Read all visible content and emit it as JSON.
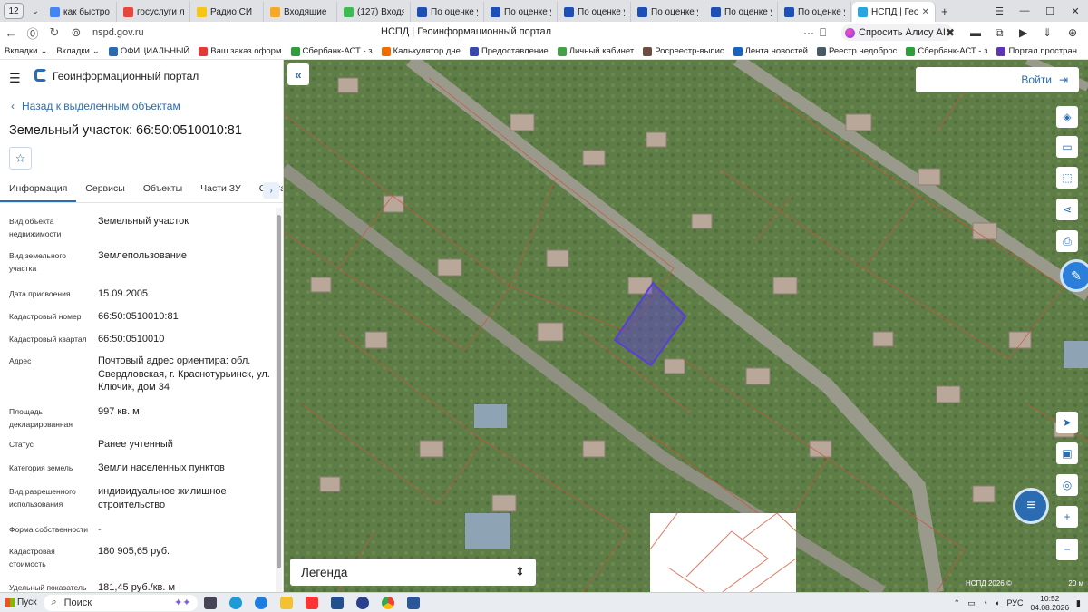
{
  "browser": {
    "tab_count": "12",
    "tabs": [
      {
        "label": "как быстро д",
        "color": "#4285f4"
      },
      {
        "label": "госуслуги ли",
        "color": "#e8453c"
      },
      {
        "label": "Радио СИ",
        "color": "#f5c518"
      },
      {
        "label": "Входящие",
        "color": "#f9a825"
      },
      {
        "label": "(127) Входящ",
        "color": "#3cba54"
      },
      {
        "label": "По оценке ур",
        "color": "#1e4fb4"
      },
      {
        "label": "По оценке ур",
        "color": "#1e4fb4"
      },
      {
        "label": "По оценке ур",
        "color": "#1e4fb4"
      },
      {
        "label": "По оценке ур",
        "color": "#1e4fb4"
      },
      {
        "label": "По оценке ур",
        "color": "#1e4fb4"
      },
      {
        "label": "По оценке ур",
        "color": "#1e4fb4"
      },
      {
        "label": "НСПД | Гео",
        "color": "#2aa6df"
      }
    ],
    "url": "nspd.gov.ru",
    "page_title": "НСПД | Геоинформационный портал",
    "alisa_label": "Спросить Алису AI",
    "bookmarks": [
      {
        "label": "Вкладки",
        "color": ""
      },
      {
        "label": "Вкладки",
        "color": ""
      },
      {
        "label": "ОФИЦИАЛЬНЫЙ",
        "color": "#2b6cb0"
      },
      {
        "label": "Ваш заказ оформ",
        "color": "#e53935"
      },
      {
        "label": "Сбербанк-АСТ - з",
        "color": "#2e9d3a"
      },
      {
        "label": "Калькулятор дне",
        "color": "#ef6c00"
      },
      {
        "label": "Предоставление",
        "color": "#3949ab"
      },
      {
        "label": "Личный кабинет",
        "color": "#43a047"
      },
      {
        "label": "Росреестр-выпис",
        "color": "#6d4c41"
      },
      {
        "label": "Лента новостей",
        "color": "#1565c0"
      },
      {
        "label": "Реестр недоброс",
        "color": "#455a64"
      },
      {
        "label": "Сбербанк-АСТ - з",
        "color": "#2e9d3a"
      },
      {
        "label": "Портал простран",
        "color": "#5e35b1"
      }
    ]
  },
  "portal": {
    "title": "Геоинформационный портал",
    "back_label": "Назад к выделенным объектам",
    "object_title": "Земельный участок: 66:50:0510010:81",
    "tabs": [
      "Информация",
      "Сервисы",
      "Объекты",
      "Части ЗУ",
      "Состав"
    ],
    "properties": [
      {
        "label": "Вид объекта недвижимости",
        "value": "Земельный участок"
      },
      {
        "label": "Вид земельного участка",
        "value": "Землепользование"
      },
      {
        "label": "Дата присвоения",
        "value": "15.09.2005"
      },
      {
        "label": "Кадастровый номер",
        "value": "66:50:0510010:81"
      },
      {
        "label": "Кадастровый квартал",
        "value": "66:50:0510010"
      },
      {
        "label": "Адрес",
        "value": "Почтовый адрес ориентира: обл. Свердловская, г. Краснотурьинск, ул. Ключик, дом 34"
      },
      {
        "label": "Площадь декларированная",
        "value": "997 кв. м"
      },
      {
        "label": "Статус",
        "value": "Ранее учтенный"
      },
      {
        "label": "Категория земель",
        "value": "Земли населенных пунктов"
      },
      {
        "label": "Вид разрешенного использования",
        "value": "индивидуальное жилищное строительство"
      },
      {
        "label": "Форма собственности",
        "value": "-"
      },
      {
        "label": "Кадастровая стоимость",
        "value": "180 905,65 руб."
      },
      {
        "label": "Удельный показатель",
        "value": "181,45 руб./кв. м"
      }
    ]
  },
  "map": {
    "login_label": "Войти",
    "legend_label": "Легенда",
    "attribution": "НСПД 2026 ©",
    "scale_label": "20 м",
    "highlight_color": "#5a3fd6"
  },
  "taskbar": {
    "start_label": "Пуск",
    "search_label": "Поиск",
    "lang": "РУС",
    "time": "10:52",
    "date": "04.08.2026"
  }
}
